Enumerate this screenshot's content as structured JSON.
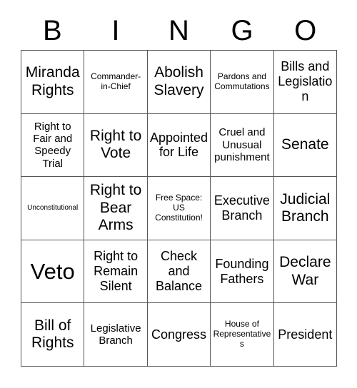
{
  "title": "BINGO",
  "header": {
    "letters": [
      "B",
      "I",
      "N",
      "G",
      "O"
    ]
  },
  "grid": {
    "columns": 5,
    "rows": 5,
    "free_space_position": {
      "row": 3,
      "column": 3
    },
    "cells": [
      [
        {
          "text": "Miranda Rights",
          "size": "lg"
        },
        {
          "text": "Commander-in-Chief",
          "size": "xs"
        },
        {
          "text": "Abolish Slavery",
          "size": "lg"
        },
        {
          "text": "Pardons and Commutations",
          "size": "xs"
        },
        {
          "text": "Bills and Legislation",
          "size": "md"
        }
      ],
      [
        {
          "text": "Right to Fair and Speedy Trial",
          "size": "sm"
        },
        {
          "text": "Right to Vote",
          "size": "lg"
        },
        {
          "text": "Appointed for Life",
          "size": "md"
        },
        {
          "text": "Cruel and Unusual punishment",
          "size": "sm"
        },
        {
          "text": "Senate",
          "size": "lg"
        }
      ],
      [
        {
          "text": "Unconstitutional",
          "size": "xxs"
        },
        {
          "text": "Right to Bear Arms",
          "size": "lg"
        },
        {
          "text": "Free Space: US Constitution!",
          "size": "xs"
        },
        {
          "text": "Executive Branch",
          "size": "md"
        },
        {
          "text": "Judicial Branch",
          "size": "lg"
        }
      ],
      [
        {
          "text": "Veto",
          "size": "xl"
        },
        {
          "text": "Right to Remain Silent",
          "size": "md"
        },
        {
          "text": "Check and Balance",
          "size": "md"
        },
        {
          "text": "Founding Fathers",
          "size": "md"
        },
        {
          "text": "Declare War",
          "size": "lg"
        }
      ],
      [
        {
          "text": "Bill of Rights",
          "size": "lg"
        },
        {
          "text": "Legislative Branch",
          "size": "sm"
        },
        {
          "text": "Congress",
          "size": "md"
        },
        {
          "text": "House of Representatives",
          "size": "xs"
        },
        {
          "text": "President",
          "size": "md"
        }
      ]
    ]
  },
  "colors": {
    "background": "#ffffff",
    "text": "#000000",
    "grid_line": "#555555"
  }
}
